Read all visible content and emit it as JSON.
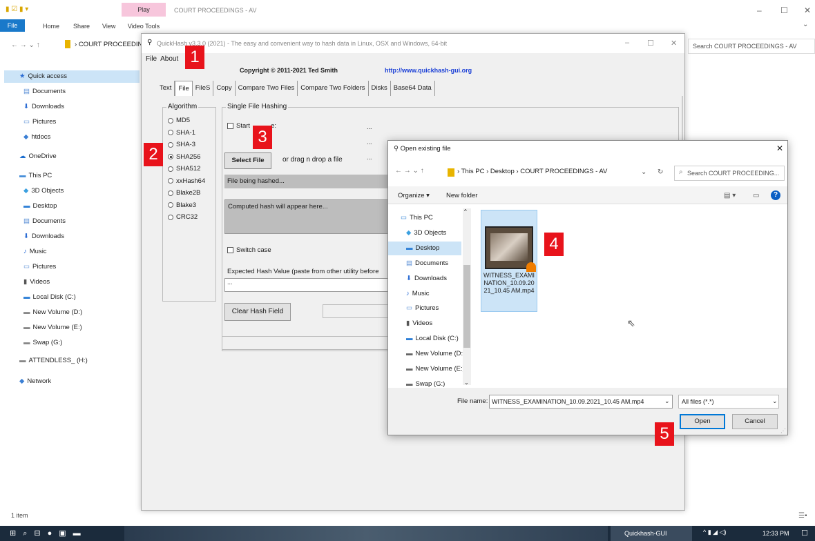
{
  "explorer": {
    "title": "COURT PROCEEDINGS - AV",
    "ribbon_tabs": {
      "file": "File",
      "home": "Home",
      "share": "Share",
      "view": "View"
    },
    "contextual": {
      "play": "Play",
      "video_tools": "Video Tools"
    },
    "address": "COURT PROCEEDING",
    "search_placeholder": "Search COURT PROCEEDINGS - AV",
    "nav": [
      "Quick access",
      "Documents",
      "Downloads",
      "Pictures",
      "htdocs",
      "OneDrive",
      "This PC",
      "3D Objects",
      "Desktop",
      "Documents",
      "Downloads",
      "Music",
      "Pictures",
      "Videos",
      "Local Disk (C:)",
      "New Volume (D:)",
      "New Volume (E:)",
      "Swap (G:)",
      "ATTENDLESS_ (H:)",
      "Network"
    ],
    "status": "1 item"
  },
  "quickhash": {
    "title": "QuickHash v3.3.0 (2021) - The easy and convenient way to hash data in Linux, OSX and Windows, 64-bit",
    "menu": {
      "file": "File",
      "about": "About"
    },
    "copyright": "Copyright © 2011-2021 Ted Smith",
    "url": "http://www.quickhash-gui.org",
    "tabs": [
      "Text",
      "File",
      "FileS",
      "Copy",
      "Compare Two Files",
      "Compare Two Folders",
      "Disks",
      "Base64 Data"
    ],
    "algorithm_label": "Algorithm",
    "algorithms": [
      "MD5",
      "SHA-1",
      "SHA-3",
      "SHA256",
      "SHA512",
      "xxHash64",
      "Blake2B",
      "Blake3",
      "CRC32"
    ],
    "selected_algorithm": "SHA256",
    "single_file_label": "Single File Hashing",
    "start_label": "Start",
    "start_label_tail": "e:",
    "dots": "...",
    "select_file": "Select File",
    "drag_label": "or drag n drop a file",
    "being_hashed": "File being hashed...",
    "computed_hash": "Computed hash will appear here...",
    "switch_case": "Switch case",
    "expected_label": "Expected Hash Value (paste from other utility before",
    "expected_value": "...",
    "clear_btn": "Clear Hash Field"
  },
  "dialog": {
    "title": "Open existing file",
    "breadcrumb": [
      "This PC",
      "Desktop",
      "COURT PROCEEDINGS - AV"
    ],
    "search_placeholder": "Search COURT PROCEEDING...",
    "organize": "Organize ▾",
    "new_folder": "New folder",
    "nav": [
      "This PC",
      "3D Objects",
      "Desktop",
      "Documents",
      "Downloads",
      "Music",
      "Pictures",
      "Videos",
      "Local Disk (C:)",
      "New Volume (D:",
      "New Volume (E:)",
      "Swap (G:)"
    ],
    "file_name_display": "WITNESS_EXAMINATION_10.09.2021_10.45 AM.mp4",
    "file_name_label": "File name:",
    "file_name_value": "WITNESS_EXAMINATION_10.09.2021_10.45 AM.mp4",
    "file_type": "All files (*.*)",
    "open": "Open",
    "cancel": "Cancel"
  },
  "taskbar": {
    "app": "Quickhash-GUI",
    "time": "12:33 PM"
  },
  "badges": [
    "1",
    "2",
    "3",
    "4",
    "5"
  ],
  "colors": {
    "accent": "#1979ca",
    "badge": "#e8131b",
    "selection": "#cce4f7"
  }
}
